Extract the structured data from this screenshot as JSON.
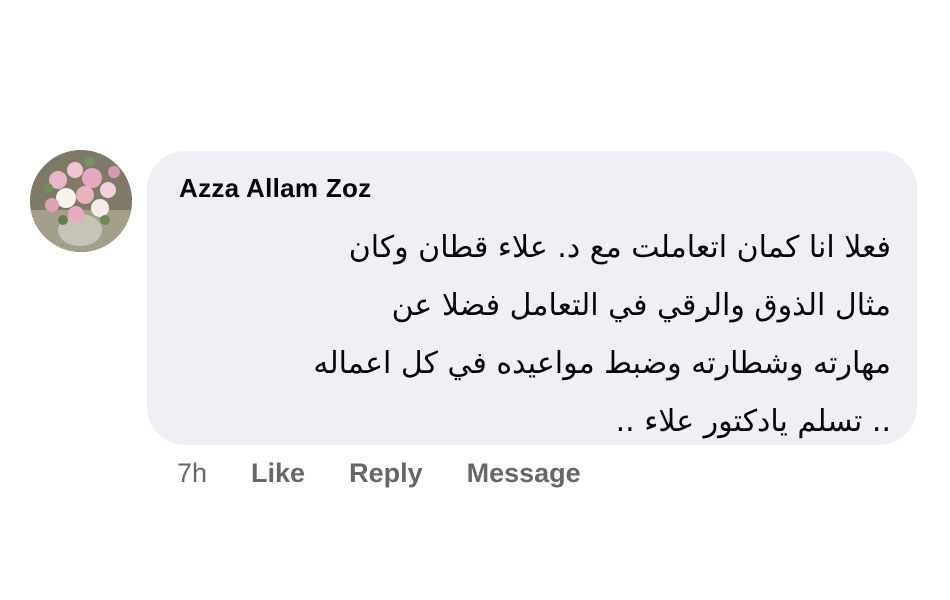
{
  "comment": {
    "avatar_icon": "rose-bouquet-avatar",
    "author": "Azza Allam Zoz",
    "text": "فعلا انا كمان اتعاملت مع د. علاء قطان وكان\nمثال الذوق والرقي في التعامل فضلا عن\nمهارته وشطارته وضبط مواعيده في كل اعماله\n.. تسلم يادكتور علاء ..",
    "timestamp": "7h",
    "actions": {
      "like": "Like",
      "reply": "Reply",
      "message": "Message"
    }
  },
  "colors": {
    "bubble_background": "#eff0f5",
    "author_text": "#050505",
    "action_text": "#65676b"
  }
}
